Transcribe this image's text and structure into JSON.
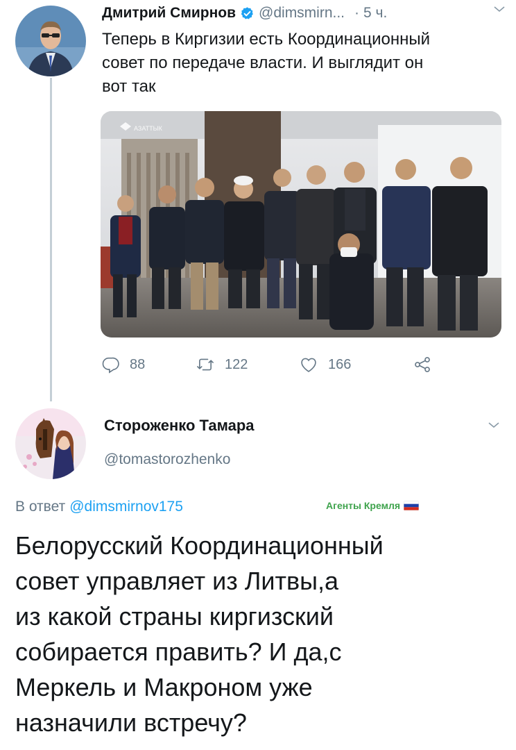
{
  "tweet": {
    "author_name": "Дмитрий Смирнов",
    "author_handle": "@dimsmirn...",
    "separator": "·",
    "time": "5 ч.",
    "text_lines": [
      "Теперь в Киргизии есть Координационный",
      "совет по передаче власти. И выглядит он",
      "вот так"
    ],
    "media_watermark": "АЗАТТЫК",
    "stats": {
      "replies": "88",
      "retweets": "122",
      "likes": "166"
    }
  },
  "reply": {
    "author_name": "Стороженко Тамара",
    "author_handle": "@tomastorozhenko",
    "in_reply_prefix": "В ответ",
    "in_reply_handle": "@dimsmirnov175",
    "badge_text": "Агенты Кремля",
    "text_lines": [
      "Белорусский Координационный",
      "совет управляет из Литвы,а",
      "из какой страны киргизский",
      "собирается править? И да,с",
      "Меркель и Макроном уже",
      "назначили встречу?"
    ]
  },
  "colors": {
    "primary_text": "#14171a",
    "secondary_text": "#657786",
    "link_blue": "#1da1f2",
    "verified_blue": "#1da1f2",
    "badge_green": "#3fa34d",
    "thread_line": "#c4cfd6"
  },
  "icons": {
    "verified": "verified-badge-icon",
    "chevron": "chevron-down-icon",
    "reply": "reply-icon",
    "retweet": "retweet-icon",
    "like": "heart-icon",
    "share": "share-icon",
    "flag": "russian-flag-icon"
  }
}
